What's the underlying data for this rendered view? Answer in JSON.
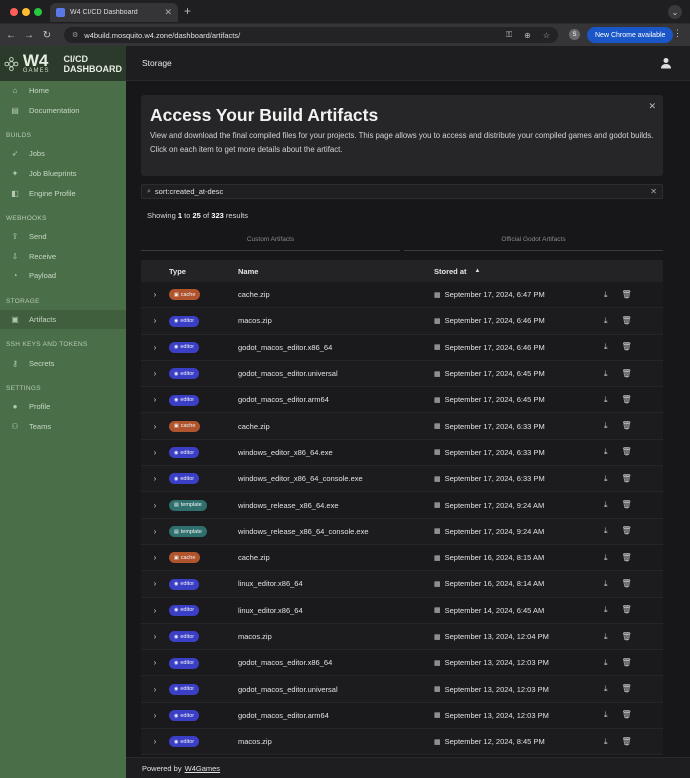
{
  "browser": {
    "tab_title": "W4 CI/CD Dashboard",
    "url": "w4build.mosquito.w4.zone/dashboard/artifacts/",
    "profile_initial": "S",
    "new_chrome_label": "New Chrome available"
  },
  "brand": {
    "w4": "W4",
    "games": "GAMES",
    "line1": "CI/CD",
    "line2": "DASHBOARD"
  },
  "sidebar": {
    "top": [
      {
        "label": "Home",
        "icon": "home-icon"
      },
      {
        "label": "Documentation",
        "icon": "book-icon"
      }
    ],
    "sections": [
      {
        "title": "BUILDS",
        "items": [
          {
            "label": "Jobs",
            "icon": "rocket-icon"
          },
          {
            "label": "Job Blueprints",
            "icon": "sparkle-icon"
          },
          {
            "label": "Engine Profile",
            "icon": "engine-icon"
          }
        ]
      },
      {
        "title": "WEBHOOKS",
        "items": [
          {
            "label": "Send",
            "icon": "upload-icon"
          },
          {
            "label": "Receive",
            "icon": "download-icon"
          },
          {
            "label": "Payload",
            "icon": "payload-icon"
          }
        ]
      },
      {
        "title": "STORAGE",
        "items": [
          {
            "label": "Artifacts",
            "icon": "archive-icon",
            "active": true
          }
        ]
      },
      {
        "title": "SSH KEYS AND TOKENS",
        "items": [
          {
            "label": "Secrets",
            "icon": "key-icon"
          }
        ]
      },
      {
        "title": "SETTINGS",
        "items": [
          {
            "label": "Profile",
            "icon": "person-icon"
          },
          {
            "label": "Teams",
            "icon": "people-icon"
          }
        ]
      }
    ]
  },
  "appbar": {
    "title": "Storage"
  },
  "hero": {
    "title": "Access Your Build Artifacts",
    "text1": "View and download the final compiled files for your projects. This page allows you to access and distribute your compiled games and godot builds.",
    "text2": "Click on each item to get more details about the artifact."
  },
  "search": {
    "value": "sort:created_at-desc"
  },
  "results": {
    "prefix": "Showing",
    "from": "1",
    "to_word": "to",
    "to": "25",
    "of_word": "of",
    "total": "323",
    "suffix": "results"
  },
  "tabs": [
    "Custom Artifacts",
    "Official Godot Artifacts"
  ],
  "table": {
    "headers": {
      "type": "Type",
      "name": "Name",
      "stored": "Stored at"
    },
    "rows": [
      {
        "type": "cache",
        "name": "cache.zip",
        "date": "September 17, 2024, 6:47 PM"
      },
      {
        "type": "editor",
        "name": "macos.zip",
        "date": "September 17, 2024, 6:46 PM"
      },
      {
        "type": "editor",
        "name": "godot_macos_editor.x86_64",
        "date": "September 17, 2024, 6:46 PM"
      },
      {
        "type": "editor",
        "name": "godot_macos_editor.universal",
        "date": "September 17, 2024, 6:45 PM"
      },
      {
        "type": "editor",
        "name": "godot_macos_editor.arm64",
        "date": "September 17, 2024, 6:45 PM"
      },
      {
        "type": "cache",
        "name": "cache.zip",
        "date": "September 17, 2024, 6:33 PM"
      },
      {
        "type": "editor",
        "name": "windows_editor_x86_64.exe",
        "date": "September 17, 2024, 6:33 PM"
      },
      {
        "type": "editor",
        "name": "windows_editor_x86_64_console.exe",
        "date": "September 17, 2024, 6:33 PM"
      },
      {
        "type": "template",
        "name": "windows_release_x86_64.exe",
        "date": "September 17, 2024, 9:24 AM"
      },
      {
        "type": "template",
        "name": "windows_release_x86_64_console.exe",
        "date": "September 17, 2024, 9:24 AM"
      },
      {
        "type": "cache",
        "name": "cache.zip",
        "date": "September 16, 2024, 8:15 AM"
      },
      {
        "type": "editor",
        "name": "linux_editor.x86_64",
        "date": "September 16, 2024, 8:14 AM"
      },
      {
        "type": "editor",
        "name": "linux_editor.x86_64",
        "date": "September 14, 2024, 6:45 AM"
      },
      {
        "type": "editor",
        "name": "macos.zip",
        "date": "September 13, 2024, 12:04 PM"
      },
      {
        "type": "editor",
        "name": "godot_macos_editor.x86_64",
        "date": "September 13, 2024, 12:03 PM"
      },
      {
        "type": "editor",
        "name": "godot_macos_editor.universal",
        "date": "September 13, 2024, 12:03 PM"
      },
      {
        "type": "editor",
        "name": "godot_macos_editor.arm64",
        "date": "September 13, 2024, 12:03 PM"
      },
      {
        "type": "editor",
        "name": "macos.zip",
        "date": "September 12, 2024, 8:45 PM"
      }
    ]
  },
  "badge_colors": {
    "cache": "#b0542d",
    "editor": "#3b3fc6",
    "template": "#2f6f6d"
  },
  "footer": {
    "prefix": "Powered by",
    "link": "W4Games"
  }
}
